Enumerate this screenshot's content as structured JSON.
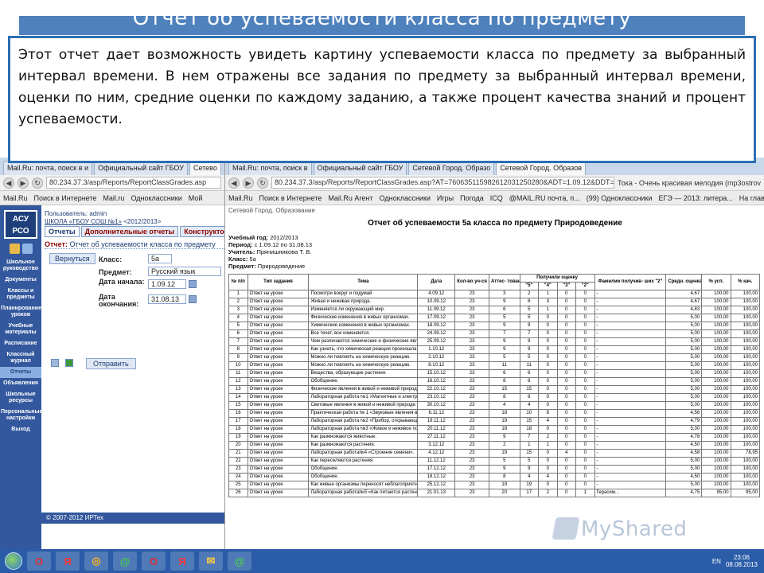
{
  "slide": {
    "title": "Отчет об успеваемости класса по предмету",
    "description": "Этот отчет дает возможность увидеть картину успеваемости класса по предмету за выбранный интервал времени. В нем отражены все задания по предмету за выбранный интервал времени, оценки по ним, средние оценки по каждому заданию, а также процент качества знаний и процент успеваемости.",
    "accent": "#4f81bd"
  },
  "left_browser": {
    "tabs": [
      "Mail.Ru: почта, поиск в и",
      "Официальный сайт ГБОУ",
      "Сетево"
    ],
    "url": "80.234.37.3/asp/Reports/ReportClassGrades.asp",
    "bookmarks": [
      "Mail.Ru",
      "Поиск в Интернете",
      "Mail.ru",
      "Одноклассники",
      "Мой"
    ],
    "app": {
      "logo": "АСУ РСО",
      "sidebar": [
        "Школьное руководство",
        "Документы",
        "Классы и предметы",
        "Планирование уроков",
        "Учебные материалы",
        "Расписание",
        "Классный журнал",
        "Отчеты",
        "Объявления",
        "Школьные ресурсы",
        "Персональные настройки",
        "Выход"
      ],
      "active_item": "Отчеты",
      "user": "Пользователь: admin",
      "school": "ШКОЛА «ГБОУ СОШ №1»",
      "year": "<2012/2013>",
      "tabs": [
        "Отчеты",
        "Дополнительные отчеты",
        "Конструктор отч"
      ],
      "report_prefix": "Отчет:",
      "report_name": "Отчет об успеваемости класса по предмету",
      "back_label": "Вернуться",
      "form": {
        "class_label": "Класс:",
        "class_value": "5а",
        "subject_label": "Предмет:",
        "subject_value": "Русский язык",
        "start_label": "Дата начала:",
        "start_value": "1.09.12",
        "end_label": "Дата окончания:",
        "end_value": "31.08.13"
      },
      "send_label": "Отправить",
      "copyright": "© 2007-2012 ИРТех"
    }
  },
  "right_browser": {
    "tabs": [
      "Mail.Ru: почта, поиск в",
      "Официальный сайт ГБОУ",
      "Сетевой Город. Образо",
      "Сетевой Город. Образов"
    ],
    "url": "80.234.37.3/asp/Reports/ReportClassGrades.asp?AT=760635115982612031250280&ADT=1.09.12&DDT=31.08.13&CLID=39689&RP=",
    "music": "Тока - Очень красивая мелодия (mp3ostrov",
    "bookmarks": [
      "Mail.Ru",
      "Поиск в Интернете",
      "Mail.Ru Агент",
      "Одноклассники",
      "Игры",
      "Погода",
      "ICQ",
      "@MAIL.RU почта, п...",
      "(99) Одноклассники",
      "ЕГЭ — 2013: литера...",
      "На главную страни..."
    ],
    "report": {
      "page_top": "Сетевой Город. Образование",
      "title": "Отчет об успеваемости 5а класса по предмету Природоведение",
      "meta": [
        {
          "label": "Учебный год:",
          "value": "2012/2013"
        },
        {
          "label": "Период:",
          "value": "с 1.09.12 по 31.08.13"
        },
        {
          "label": "Учитель:",
          "value": "Прянишникова Т. В."
        },
        {
          "label": "Класс:",
          "value": "5а"
        },
        {
          "label": "Предмет:",
          "value": "Природоведение"
        }
      ],
      "headers": [
        "№ п/п",
        "Тип задания",
        "Тема",
        "Дата",
        "Кол-во уч-ся в классе",
        "Аттес- товано",
        "Получили оценку",
        "Фамилии получив- ших \"2\"",
        "Средн. оценка",
        "% усп.",
        "% кач."
      ],
      "grade_headers": [
        "\"5\"",
        "\"4\"",
        "\"3\"",
        "\"2\""
      ],
      "rows": [
        [
          "1",
          "Ответ на уроке",
          "Посмотри вокруг и подумай",
          "4.09.12",
          "23",
          "3",
          "2",
          "1",
          "0",
          "0",
          "-",
          "4,67",
          "100,00",
          "100,00"
        ],
        [
          "2",
          "Ответ на уроке",
          "Живая и неживая природа.",
          "10.09.12",
          "23",
          "9",
          "6",
          "3",
          "0",
          "0",
          "-",
          "4,67",
          "100,00",
          "100,00"
        ],
        [
          "3",
          "Ответ на уроке",
          "Изменяется ли окружающий мир.",
          "11.09.12",
          "23",
          "6",
          "5",
          "1",
          "0",
          "0",
          "-",
          "4,83",
          "100,00",
          "100,00"
        ],
        [
          "4",
          "Ответ на уроке",
          "Физические изменения в живых организмах.",
          "17.09.12",
          "23",
          "5",
          "5",
          "0",
          "0",
          "0",
          "-",
          "5,00",
          "100,00",
          "100,00"
        ],
        [
          "5",
          "Ответ на уроке",
          "Химические изменения в живых организмах.",
          "18.09.12",
          "23",
          "9",
          "9",
          "0",
          "0",
          "0",
          "-",
          "5,00",
          "100,00",
          "100,00"
        ],
        [
          "6",
          "Ответ на уроке",
          "Все течет, все изменяется.",
          "24.09.12",
          "23",
          "7",
          "7",
          "0",
          "0",
          "0",
          "-",
          "5,00",
          "100,00",
          "100,00"
        ],
        [
          "7",
          "Ответ на уроке",
          "Чем различаются химические и физические явления.",
          "25.09.12",
          "23",
          "9",
          "9",
          "0",
          "0",
          "0",
          "-",
          "5,00",
          "100,00",
          "100,00"
        ],
        [
          "8",
          "Ответ на уроке",
          "Как узнать, что химическая реакция произошла.",
          "1.10.12",
          "23",
          "9",
          "9",
          "0",
          "0",
          "0",
          "-",
          "5,00",
          "100,00",
          "100,00"
        ],
        [
          "9",
          "Ответ на уроке",
          "Можно ли повлиять на химическую реакцию.",
          "2.10.12",
          "23",
          "5",
          "5",
          "0",
          "0",
          "0",
          "-",
          "5,00",
          "100,00",
          "100,00"
        ],
        [
          "10",
          "Ответ на уроке",
          "Можно ли повлиять на химическую реакцию.",
          "8.10.12",
          "23",
          "11",
          "11",
          "0",
          "0",
          "0",
          "-",
          "5,00",
          "100,00",
          "100,00"
        ],
        [
          "11",
          "Ответ на уроке",
          "Вещества, образующие растения.",
          "15.10.12",
          "23",
          "6",
          "6",
          "0",
          "0",
          "0",
          "-",
          "5,00",
          "100,00",
          "100,00"
        ],
        [
          "12",
          "Ответ на уроке",
          "Обобщение.",
          "16.10.12",
          "23",
          "8",
          "8",
          "0",
          "0",
          "0",
          "-",
          "5,00",
          "100,00",
          "100,00"
        ],
        [
          "13",
          "Ответ на уроке",
          "Физические явления в живой и неживой природе.",
          "22.10.12",
          "23",
          "15",
          "15",
          "0",
          "0",
          "0",
          "-",
          "5,00",
          "100,00",
          "100,00"
        ],
        [
          "14",
          "Ответ на уроке",
          "Лабораторная работа №1 «Магнитные и электрические явления».",
          "23.10.12",
          "23",
          "8",
          "8",
          "0",
          "0",
          "0",
          "-",
          "5,00",
          "100,00",
          "100,00"
        ],
        [
          "15",
          "Ответ на уроке",
          "Световые явления в живой и неживой природе.",
          "30.10.12",
          "23",
          "4",
          "4",
          "0",
          "0",
          "0",
          "-",
          "5,00",
          "100,00",
          "100,00"
        ],
        [
          "16",
          "Ответ на уроке",
          "Практическая работа № 1 «Звуковые явления в живой и неживой природе».",
          "6.11.12",
          "23",
          "18",
          "10",
          "8",
          "0",
          "0",
          "-",
          "4,56",
          "100,00",
          "100,00"
        ],
        [
          "17",
          "Ответ на уроке",
          "Лабораторная работа №2 «Прибор, открывающий тайны»",
          "19.11.12",
          "23",
          "19",
          "15",
          "4",
          "0",
          "0",
          "-",
          "4,79",
          "100,00",
          "100,00"
        ],
        [
          "18",
          "Ответ на уроке",
          "Лабораторная работа №3 «Живое и неживое под микроскопом».",
          "20.11.12",
          "23",
          "18",
          "18",
          "0",
          "0",
          "0",
          "-",
          "5,00",
          "100,00",
          "100,00"
        ],
        [
          "19",
          "Ответ на уроке",
          "Как размножаются животные.",
          "27.11.12",
          "23",
          "9",
          "7",
          "2",
          "0",
          "0",
          "-",
          "4,78",
          "100,00",
          "100,00"
        ],
        [
          "20",
          "Ответ на уроке",
          "Как размножаются растения.",
          "3.12.12",
          "23",
          "2",
          "1",
          "1",
          "0",
          "0",
          "-",
          "4,50",
          "100,00",
          "100,00"
        ],
        [
          "21",
          "Ответ на уроке",
          "Лабораторная работа№4 «Строение семени».",
          "4.12.12",
          "23",
          "19",
          "15",
          "0",
          "4",
          "0",
          "-",
          "4,58",
          "100,00",
          "78,95"
        ],
        [
          "22",
          "Ответ на уроке",
          "Как переселяются растения.",
          "11.12.12",
          "23",
          "5",
          "5",
          "0",
          "0",
          "0",
          "-",
          "5,00",
          "100,00",
          "100,00"
        ],
        [
          "23",
          "Ответ на уроке",
          "Обобщение.",
          "17.12.12",
          "23",
          "9",
          "9",
          "0",
          "0",
          "0",
          "-",
          "5,00",
          "100,00",
          "100,00"
        ],
        [
          "24",
          "Ответ на уроке",
          "Обобщение.",
          "18.12.12",
          "23",
          "8",
          "4",
          "4",
          "0",
          "0",
          "-",
          "4,50",
          "100,00",
          "100,00"
        ],
        [
          "25",
          "Ответ на уроке",
          "Как живые организмы переносят неблагоприятные для жизни условия",
          "25.12.12",
          "23",
          "19",
          "19",
          "0",
          "0",
          "0",
          "-",
          "5,00",
          "100,00",
          "100,00"
        ],
        [
          "26",
          "Ответ на уроке",
          "Лабораторная работа№5 «Как питаются растения».",
          "21.01.13",
          "23",
          "20",
          "17",
          "2",
          "0",
          "1",
          "Герасим...",
          "4,75",
          "95,00",
          "95,00"
        ]
      ]
    }
  },
  "taskbar": {
    "apps": [
      "O",
      "Я",
      "◎",
      "@",
      "O",
      "Я",
      "✉",
      "@"
    ],
    "lang": "EN",
    "time": "23:06",
    "date": "08.08.2013"
  },
  "watermark": "MyShared"
}
